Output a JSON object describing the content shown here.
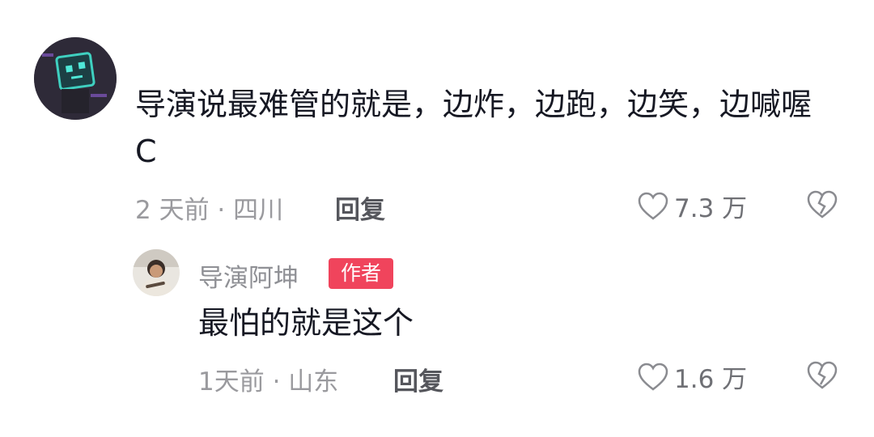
{
  "comment": {
    "text": "导演说最难管的就是，边炸，边跑，边笑，边喊喔 C",
    "meta": "2 天前 · 四川",
    "reply_label": "回复",
    "likes": "7.3 万",
    "avatar_icon": "robot-avatar-icon"
  },
  "reply": {
    "author": "导演阿坤",
    "badge": "作者",
    "text": "最怕的就是这个",
    "meta": "1天前 · 山东",
    "reply_label": "回复",
    "likes": "1.6 万",
    "avatar_icon": "person-avatar-icon"
  },
  "colors": {
    "badge_bg": "#f0445c",
    "text_primary": "#161823",
    "text_meta": "#9a9a9e"
  }
}
